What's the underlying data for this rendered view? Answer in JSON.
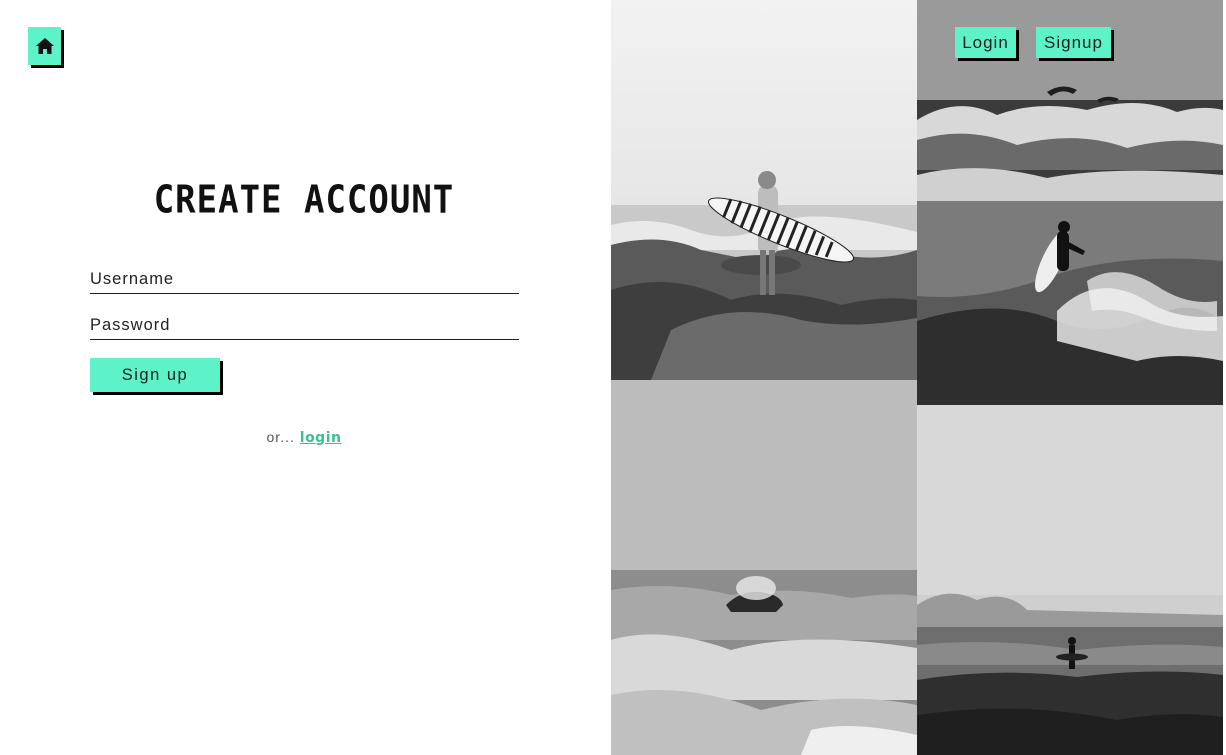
{
  "header": {
    "home_icon": "home-icon",
    "nav": {
      "login_label": "Login",
      "signup_label": "Signup"
    }
  },
  "form": {
    "title": "CREATE ACCOUNT",
    "username_placeholder": "Username",
    "password_placeholder": "Password",
    "submit_label": "Sign up",
    "alt_prefix": "or...",
    "alt_link_label": "login"
  },
  "colors": {
    "accent": "#5ef2c8",
    "link": "#3bbf95",
    "shadow": "#000000"
  }
}
